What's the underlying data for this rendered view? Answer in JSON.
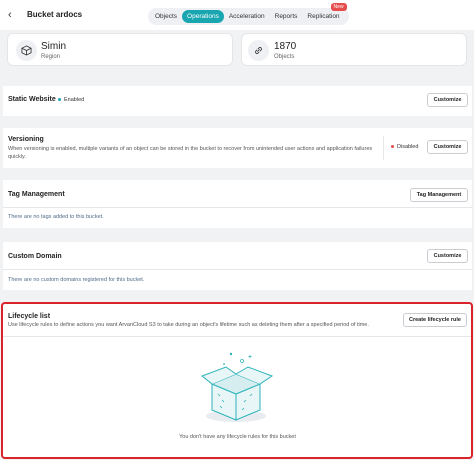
{
  "header": {
    "back_icon": "chevron-left-icon",
    "bucket_title": "Bucket  ardocs",
    "tabs": [
      {
        "label": "Objects",
        "active": false
      },
      {
        "label": "Operations",
        "active": true
      },
      {
        "label": "Acceleration",
        "active": false
      },
      {
        "label": "Reports",
        "active": false
      },
      {
        "label": "Replication",
        "active": false,
        "badge": "New"
      }
    ]
  },
  "stats": {
    "region": {
      "value": "Simin",
      "label": "Region",
      "icon": "cube-icon"
    },
    "objects": {
      "value": "1870",
      "label": "Objects",
      "icon": "link-icon"
    }
  },
  "static_website": {
    "title": "Static Website",
    "status": "Enabled",
    "status_color": "#1aa6b0",
    "button": "Customize"
  },
  "versioning": {
    "title": "Versioning",
    "description": "When versioning is enabled, multiple variants of an object can be stored in the bucket to recover from unintended user actions and application failures quickly.",
    "status": "Disabled",
    "status_color": "#e74c4c",
    "button": "Customize"
  },
  "tag_management": {
    "title": "Tag Management",
    "empty_text": "There are no tags added to this bucket.",
    "button": "Tag Management"
  },
  "custom_domain": {
    "title": "Custom Domain",
    "empty_text": "There are no custom domains registered for this bucket.",
    "button": "Customize"
  },
  "lifecycle": {
    "title": "Lifecycle list",
    "description": "Use lifecycle rules to define actions you want ArvanCloud S3 to take during an object's lifetime such as deleting them after a specified period of time.",
    "button": "Create lifecycle rule",
    "empty_text": "You don't have any lifecycle rules for this bucket",
    "illustration": "empty-box-icon"
  },
  "colors": {
    "accent": "#1aa6b0",
    "highlight": "#d9242b"
  }
}
